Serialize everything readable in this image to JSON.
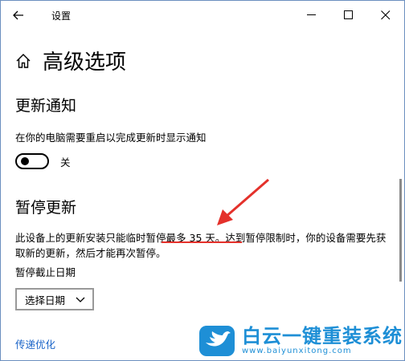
{
  "window": {
    "title": "设置"
  },
  "page": {
    "heading": "高级选项"
  },
  "update_notify": {
    "section_title": "更新通知",
    "description": "在你的电脑需要重启以完成更新时显示通知",
    "toggle_state": "关",
    "toggle_on": false
  },
  "pause": {
    "section_title": "暂停更新",
    "desc_part1": "此设备上的更新安装只能临时",
    "desc_highlight": "暂停最多 35 天",
    "desc_part2": "。达到暂停限制时，你的设备需要先获取新的更新，然后才能再次暂停。",
    "date_label": "暂停截止日期",
    "select_value": "选择日期"
  },
  "link": {
    "label": "传递优化"
  },
  "watermark": {
    "title": "白云一键重装系统",
    "url": "www.baiyunxitong.com"
  },
  "colors": {
    "link": "#1a64c8",
    "annotation": "#e4312b",
    "watermark": "#1e8fd6"
  }
}
